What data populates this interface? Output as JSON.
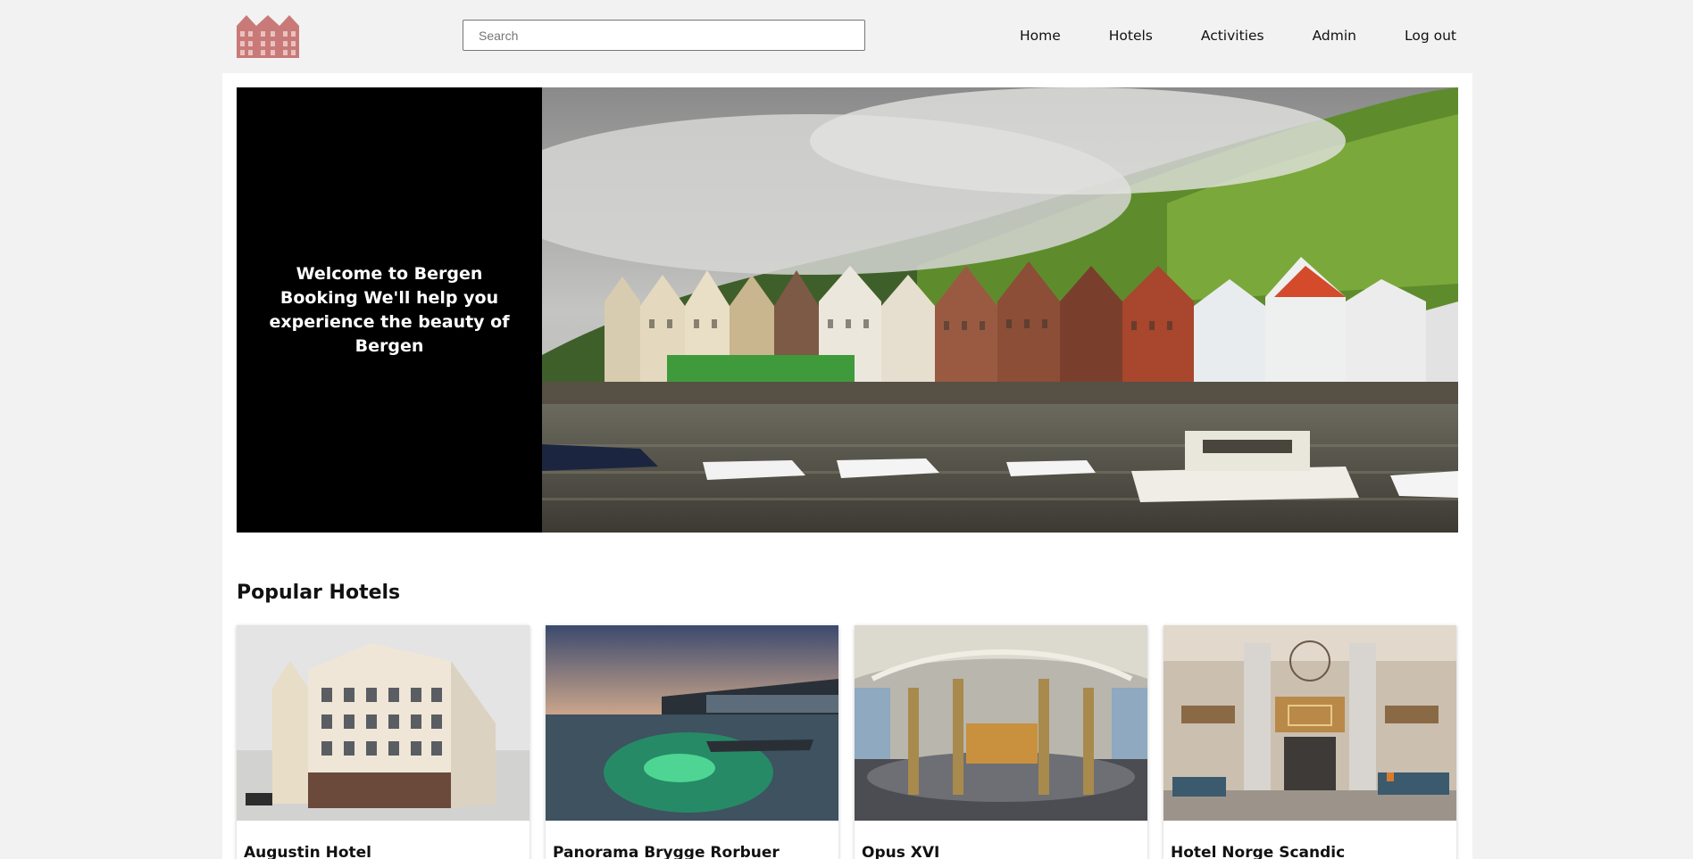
{
  "header": {
    "logo_icon": "building-houses-icon",
    "search": {
      "placeholder": "Search",
      "value": ""
    },
    "nav": [
      {
        "label": "Home"
      },
      {
        "label": "Hotels"
      },
      {
        "label": "Activities"
      },
      {
        "label": "Admin"
      },
      {
        "label": "Log out"
      }
    ]
  },
  "hero": {
    "headline": "Welcome to Bergen Booking We'll help you experience the beauty of Bergen"
  },
  "popular": {
    "title": "Popular Hotels",
    "hotels": [
      {
        "name": "Augustin Hotel"
      },
      {
        "name": "Panorama Brygge Rorbuer"
      },
      {
        "name": "Opus XVI"
      },
      {
        "name": "Hotel Norge Scandic"
      }
    ]
  },
  "colors": {
    "logo": "#c97a78",
    "hero_panel": "#000000",
    "page_bg": "#f2f2f2"
  }
}
